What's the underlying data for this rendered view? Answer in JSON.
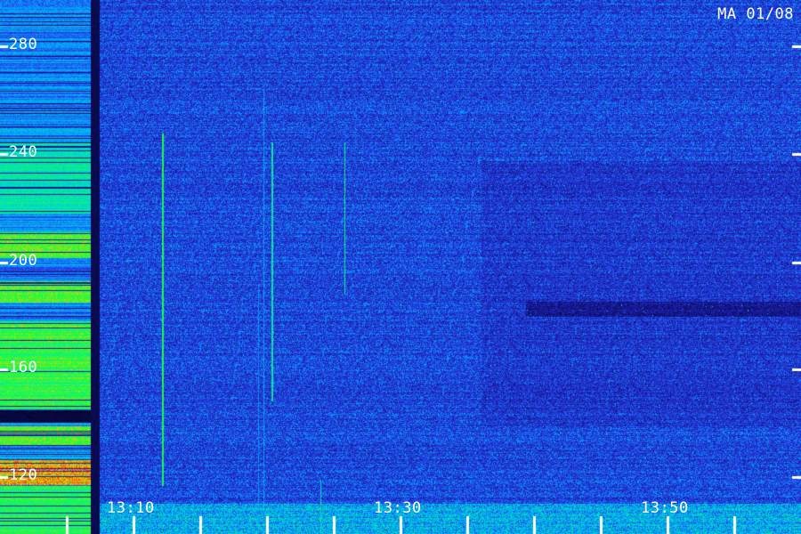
{
  "station_label": "MA 01/08",
  "y_axis": {
    "ticks": [
      "280",
      "240",
      "200",
      "160",
      "120"
    ]
  },
  "x_axis": {
    "ticks": [
      "13:10",
      "13:30",
      "13:50"
    ]
  },
  "colors": {
    "background": "#0a0a4a",
    "low": "#1a1aa0",
    "mid": "#00c0ff",
    "high": "#20ff40",
    "peak": "#ff6020",
    "tick": "#ffffff"
  }
}
